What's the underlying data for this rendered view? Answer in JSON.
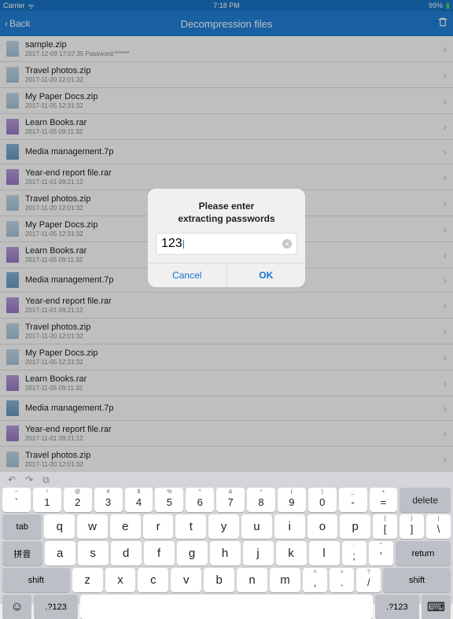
{
  "status": {
    "carrier": "Carrier",
    "time": "7:18 PM",
    "battery": "99%"
  },
  "nav": {
    "back": "Back",
    "title": "Decompression files"
  },
  "files": [
    {
      "name": "sample.zip",
      "date": "2017-12-09 17:07:35 Password:******",
      "t": "zip"
    },
    {
      "name": "Travel photos.zip",
      "date": "2017-11-20 12:01:32",
      "t": "zip"
    },
    {
      "name": "My Paper Docs.zip",
      "date": "2017-11-05 12:31:32",
      "t": "zip"
    },
    {
      "name": "Learn Books.rar",
      "date": "2017-11-05 09:11:32",
      "t": "rar"
    },
    {
      "name": "Media management.7p",
      "date": "",
      "t": "sp"
    },
    {
      "name": "Year-end report file.rar",
      "date": "2017-11-01 09:21:12",
      "t": "rar"
    },
    {
      "name": "Travel photos.zip",
      "date": "2017-11-20 12:01:32",
      "t": "zip"
    },
    {
      "name": "My Paper Docs.zip",
      "date": "2017-11-05 12:31:32",
      "t": "zip"
    },
    {
      "name": "Learn Books.rar",
      "date": "2017-11-05 09:11:32",
      "t": "rar"
    },
    {
      "name": "Media management.7p",
      "date": "",
      "t": "sp"
    },
    {
      "name": "Year-end report file.rar",
      "date": "2017-11-01 09:21:12",
      "t": "rar"
    },
    {
      "name": "Travel photos.zip",
      "date": "2017-11-20 12:01:32",
      "t": "zip"
    },
    {
      "name": "My Paper Docs.zip",
      "date": "2017-11-05 12:31:32",
      "t": "zip"
    },
    {
      "name": "Learn Books.rar",
      "date": "2017-11-05 09:11:32",
      "t": "rar"
    },
    {
      "name": "Media management.7p",
      "date": "",
      "t": "sp"
    },
    {
      "name": "Year-end report file.rar",
      "date": "2017-11-01 09:21:12",
      "t": "rar"
    },
    {
      "name": "Travel photos.zip",
      "date": "2017-11-20 12:01:32",
      "t": "zip"
    }
  ],
  "alert": {
    "title_l1": "Please enter",
    "title_l2": "extracting passwords",
    "value": "123",
    "cancel": "Cancel",
    "ok": "OK"
  },
  "keyboard": {
    "r1": [
      [
        "~",
        "`"
      ],
      [
        "!",
        "1"
      ],
      [
        "@",
        "2"
      ],
      [
        "#",
        "3"
      ],
      [
        "$",
        "4"
      ],
      [
        "%",
        "5"
      ],
      [
        "^",
        "6"
      ],
      [
        "&",
        "7"
      ],
      [
        "*",
        "8"
      ],
      [
        "(",
        "9"
      ],
      [
        ")",
        "0"
      ],
      [
        "_",
        "-"
      ],
      [
        "+",
        "="
      ]
    ],
    "r2": [
      "q",
      "w",
      "e",
      "r",
      "t",
      "y",
      "u",
      "i",
      "o",
      "p"
    ],
    "r2b": [
      [
        "{",
        "["
      ],
      [
        "}",
        "]"
      ],
      [
        "|",
        "\\"
      ]
    ],
    "r3": [
      "a",
      "s",
      "d",
      "f",
      "g",
      "h",
      "j",
      "k",
      "l"
    ],
    "r3b": [
      [
        ":",
        ";"
      ],
      [
        "\"",
        "'"
      ]
    ],
    "r4": [
      "z",
      "x",
      "c",
      "v",
      "b",
      "n",
      "m"
    ],
    "r4b": [
      [
        "<",
        ","
      ],
      [
        ">",
        "."
      ],
      [
        "?",
        "/"
      ]
    ],
    "delete": "delete",
    "tab": "tab",
    "pinyin": "拼音",
    "return": "return",
    "shift": "shift",
    "num": ".?123"
  }
}
